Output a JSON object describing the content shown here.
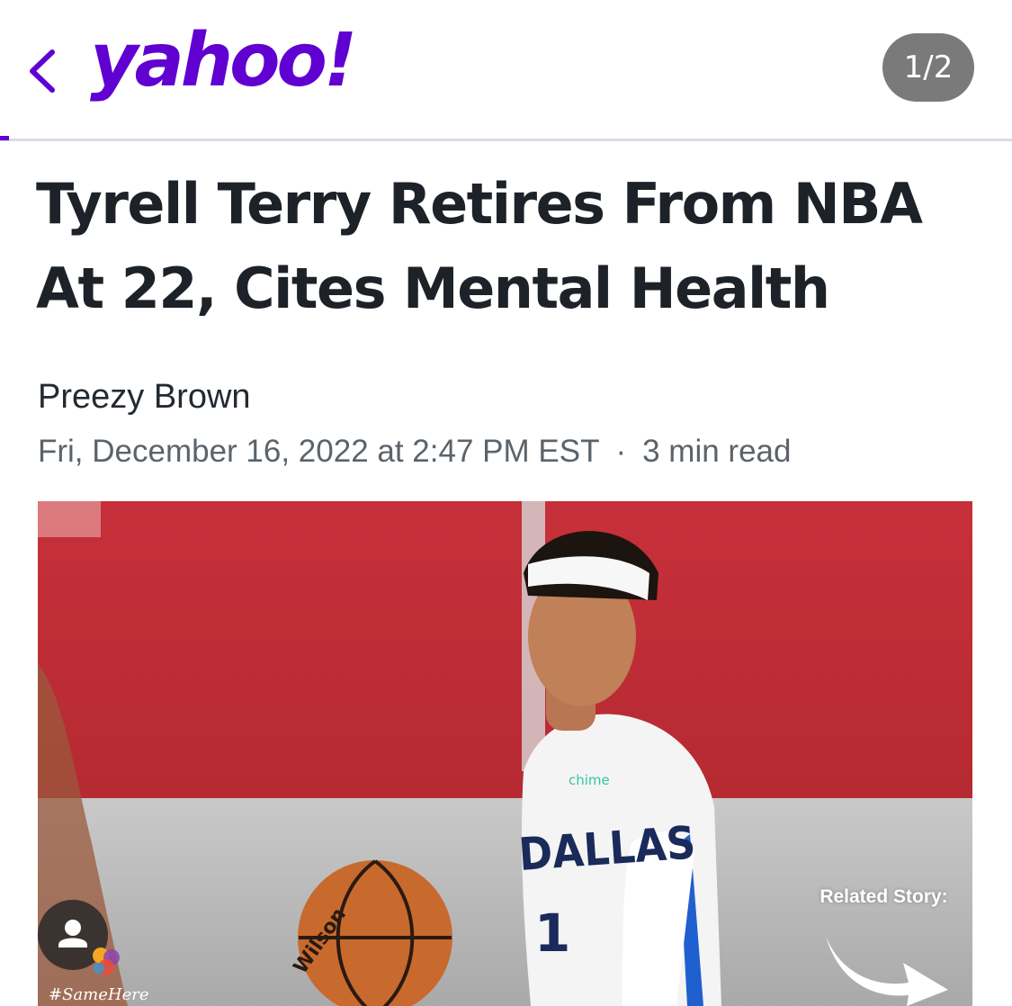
{
  "header": {
    "back_icon": "chevron-left-icon",
    "logo_text": "yahoo!",
    "page_indicator": "1/2",
    "brand_color": "#6001d2"
  },
  "article": {
    "headline_line1": "Tyrell Terry Retires From NBA",
    "headline_line2": "At 22, Cites Mental Health",
    "author": "Preezy Brown",
    "date": "Fri, December 16, 2022 at 2:47 PM EST",
    "separator": "·",
    "read_time": "3 min read"
  },
  "hero": {
    "jersey_text": "DALLAS",
    "jersey_number": "1",
    "sponsor_text": "chime",
    "ball_text": "Wilson",
    "related_label": "Related Story:",
    "tag_text": "#SameHere",
    "avatar_icon": "user-icon",
    "arrow_icon": "arrow-right-icon"
  }
}
